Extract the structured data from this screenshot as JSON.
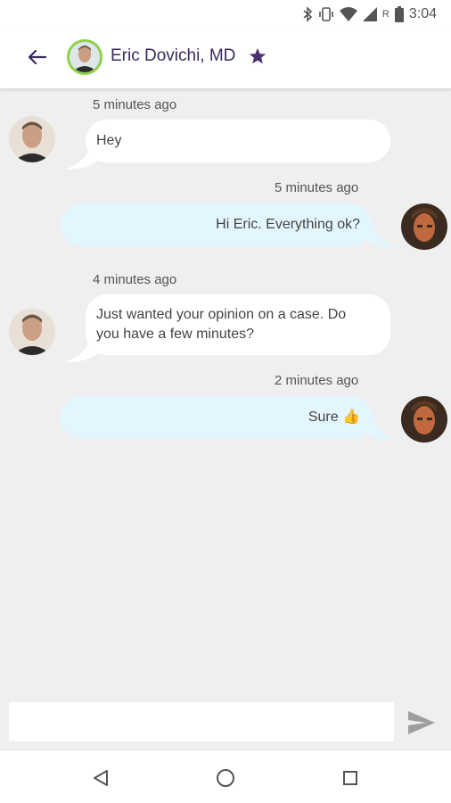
{
  "status_bar": {
    "time": "3:04",
    "network_label": "R",
    "icons": [
      "bluetooth-icon",
      "vibrate-icon",
      "wifi-icon",
      "signal-icon",
      "battery-icon"
    ]
  },
  "header": {
    "title": "Eric Dovichi, MD",
    "icons": [
      "back-arrow-icon",
      "star-icon"
    ],
    "colors": {
      "title": "#3b2a5e",
      "avatar_ring": "#8fd14a",
      "star": "#4a3270"
    }
  },
  "messages": [
    {
      "sender": "Eric",
      "direction": "incoming",
      "time": "5 minutes ago",
      "lines": [
        "Hey"
      ]
    },
    {
      "sender": "Me",
      "direction": "outgoing",
      "time": "5 minutes ago",
      "lines": [
        "Hi Eric. Everything ok?"
      ]
    },
    {
      "sender": "Eric",
      "direction": "incoming",
      "time": "4 minutes ago",
      "lines": [
        "Just wanted your opinion on a case. Do",
        "you have a few minutes?"
      ]
    },
    {
      "sender": "Me",
      "direction": "outgoing",
      "time": "2 minutes ago",
      "lines": [
        "Sure 👍"
      ]
    }
  ],
  "composer": {
    "placeholder": "",
    "value": "",
    "send_icon": "send-icon"
  },
  "colors": {
    "incoming_bubble": "#ffffff",
    "outgoing_bubble": "#e3f6fd",
    "background": "#efefef"
  },
  "nav_bar": {
    "icons": [
      "back-triangle-icon",
      "home-circle-icon",
      "recents-square-icon"
    ]
  }
}
